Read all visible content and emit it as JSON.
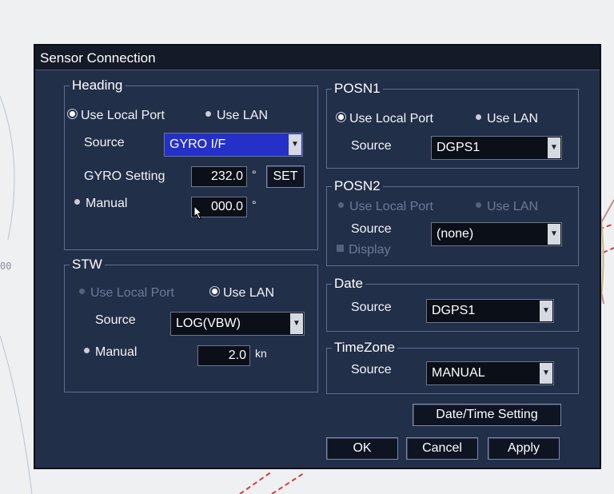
{
  "background": {
    "scale_text": "00"
  },
  "dialog": {
    "title": "Sensor Connection",
    "heading": {
      "label": "Heading",
      "radio_local": "Use Local Port",
      "radio_lan": "Use LAN",
      "source_label": "Source",
      "source_value": "GYRO I/F",
      "gyro_label": "GYRO Setting",
      "gyro_value": "232.0",
      "gyro_unit": "°",
      "set_button": "SET",
      "manual_label": "Manual",
      "manual_value": "000.0",
      "manual_unit": "°"
    },
    "stw": {
      "label": "STW",
      "radio_local": "Use Local Port",
      "radio_lan": "Use LAN",
      "source_label": "Source",
      "source_value": "LOG(VBW)",
      "manual_label": "Manual",
      "manual_value": "2.0",
      "manual_unit": "kn"
    },
    "posn1": {
      "label": "POSN1",
      "radio_local": "Use Local Port",
      "radio_lan": "Use LAN",
      "source_label": "Source",
      "source_value": "DGPS1"
    },
    "posn2": {
      "label": "POSN2",
      "radio_local": "Use Local Port",
      "radio_lan": "Use LAN",
      "source_label": "Source",
      "source_value": "(none)",
      "display_label": "Display"
    },
    "date": {
      "label": "Date",
      "source_label": "Source",
      "source_value": "DGPS1"
    },
    "timezone": {
      "label": "TimeZone",
      "source_label": "Source",
      "source_value": "MANUAL"
    },
    "buttons": {
      "datetime": "Date/Time Setting",
      "ok": "OK",
      "cancel": "Cancel",
      "apply": "Apply"
    }
  },
  "colors": {
    "dialog_bg": "#222f49",
    "selected_dropdown": "#2430c8",
    "field_bg": "#0b0f17"
  }
}
